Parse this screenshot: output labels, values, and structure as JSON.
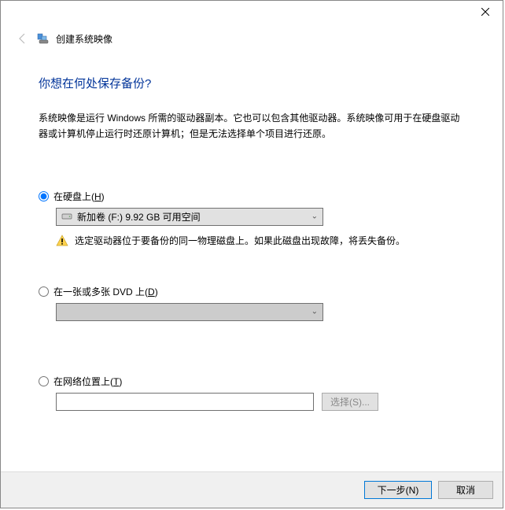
{
  "header": {
    "title": "创建系统映像"
  },
  "main": {
    "heading": "你想在何处保存备份?",
    "description": "系统映像是运行 Windows 所需的驱动器副本。它也可以包含其他驱动器。系统映像可用于在硬盘驱动器或计算机停止运行时还原计算机；但是无法选择单个项目进行还原。"
  },
  "options": {
    "hdd": {
      "label_pre": "在硬盘上(",
      "accel": "H",
      "label_post": ")",
      "selected": "新加卷 (F:)  9.92 GB 可用空间",
      "warning": "选定驱动器位于要备份的同一物理磁盘上。如果此磁盘出现故障，将丢失备份。"
    },
    "dvd": {
      "label_pre": "在一张或多张 DVD 上(",
      "accel": "D",
      "label_post": ")"
    },
    "network": {
      "label_pre": "在网络位置上(",
      "accel": "T",
      "label_post": ")",
      "select_btn": "选择(S)..."
    }
  },
  "footer": {
    "next": "下一步(N)",
    "cancel": "取消"
  }
}
